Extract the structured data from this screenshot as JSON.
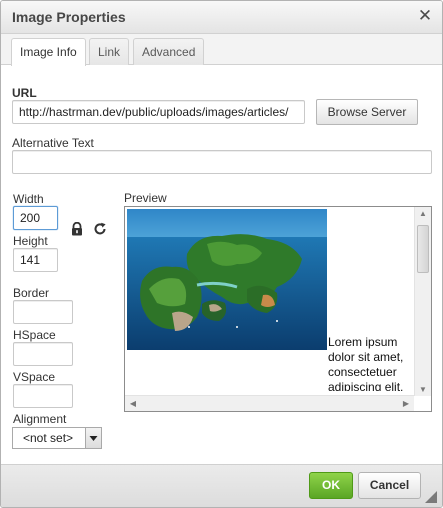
{
  "dialog": {
    "title": "Image Properties",
    "close_glyph": "✕"
  },
  "tabs": [
    {
      "label": "Image Info",
      "active": true
    },
    {
      "label": "Link",
      "active": false
    },
    {
      "label": "Advanced",
      "active": false
    }
  ],
  "form": {
    "url_label": "URL",
    "url_value": "http://hastrman.dev/public/uploads/images/articles/",
    "browse_label": "Browse Server",
    "alt_label": "Alternative Text",
    "alt_value": "",
    "width_label": "Width",
    "width_value": "200",
    "height_label": "Height",
    "height_value": "141",
    "lock_icon": "lock-icon",
    "reset_icon": "reset-size-icon",
    "border_label": "Border",
    "border_value": "",
    "hspace_label": "HSpace",
    "hspace_value": "",
    "vspace_label": "VSpace",
    "vspace_value": "",
    "alignment_label": "Alignment",
    "alignment_value": "<not set>"
  },
  "preview": {
    "label": "Preview",
    "text": "Lorem ipsum dolor sit amet, consectetuer adipiscing elit. Maecenas feugiat consequat diam. Maecenas metus. Vivamus diam purus, cursus a, commodo"
  },
  "footer": {
    "ok_label": "OK",
    "cancel_label": "Cancel"
  },
  "colors": {
    "ok_green": "#6cba2c",
    "focus_blue": "#5d9bd6",
    "title_text": "#474747"
  }
}
